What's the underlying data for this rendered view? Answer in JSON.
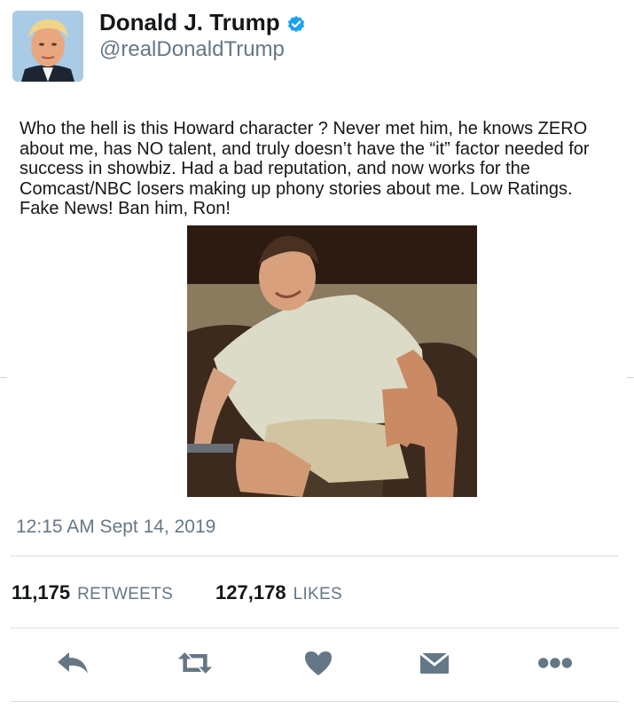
{
  "author": {
    "display_name": "Donald J. Trump",
    "handle": "@realDonaldTrump",
    "verified_icon": "verified-badge-icon",
    "avatar_icon": "profile-photo"
  },
  "tweet": {
    "text": "Who the hell is this Howard character ? Never met him, he knows ZERO\nabout me, has NO talent, and truly doesn’t have the “it” factor needed for\nsuccess in showbiz. Had a bad reputation, and now works for the\nComcast/NBC losers making up phony stories about me. Low Ratings.\nFake News! Ban him, Ron!",
    "timestamp": "12:15 AM Sept 14, 2019"
  },
  "stats": {
    "retweets_count": "11,175",
    "retweets_label": "RETWEETS",
    "likes_count": "127,178",
    "likes_label": "LIKES"
  },
  "actions": [
    {
      "name": "reply",
      "icon": "reply-icon"
    },
    {
      "name": "retweet",
      "icon": "retweet-icon"
    },
    {
      "name": "like",
      "icon": "heart-icon"
    },
    {
      "name": "direct-message",
      "icon": "envelope-icon"
    },
    {
      "name": "more",
      "icon": "more-dots-icon"
    }
  ],
  "colors": {
    "text": "#14171a",
    "secondary": "#657786",
    "verified": "#1da1f2",
    "action_icon": "#657786"
  }
}
